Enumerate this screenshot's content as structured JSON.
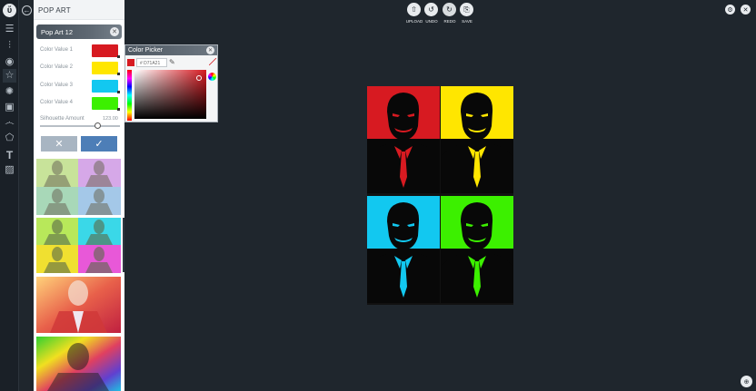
{
  "panel": {
    "title": "POP ART",
    "preset_name": "Pop Art 12",
    "colors": [
      {
        "label": "Color Value 1",
        "hex": "#d71a21"
      },
      {
        "label": "Color Value 2",
        "hex": "#ffe600"
      },
      {
        "label": "Color Value 3",
        "hex": "#12c8f0"
      },
      {
        "label": "Color Value 4",
        "hex": "#3cf000"
      }
    ],
    "silhouette_label": "Silhouette Amount",
    "silhouette_value": "123.00",
    "cancel_icon": "close-icon",
    "apply_icon": "check-icon"
  },
  "picker": {
    "title": "Color Picker",
    "hex_value": "# D71A21"
  },
  "toolbar": {
    "upload": "UPLOAD",
    "undo": "UNDO",
    "redo": "REDO",
    "save": "SAVE"
  },
  "icons": [
    "logo-icon",
    "layers-icon",
    "adjust-icon",
    "eye-icon",
    "star-icon",
    "sun-icon",
    "frame-icon",
    "mustache-icon",
    "shape-icon",
    "text-icon",
    "texture-icon",
    "back-icon",
    "settings-icon",
    "close-icon",
    "zoom-icon"
  ],
  "art_colors": [
    "#d71a21",
    "#ffe600",
    "#12c8f0",
    "#3cf000"
  ]
}
